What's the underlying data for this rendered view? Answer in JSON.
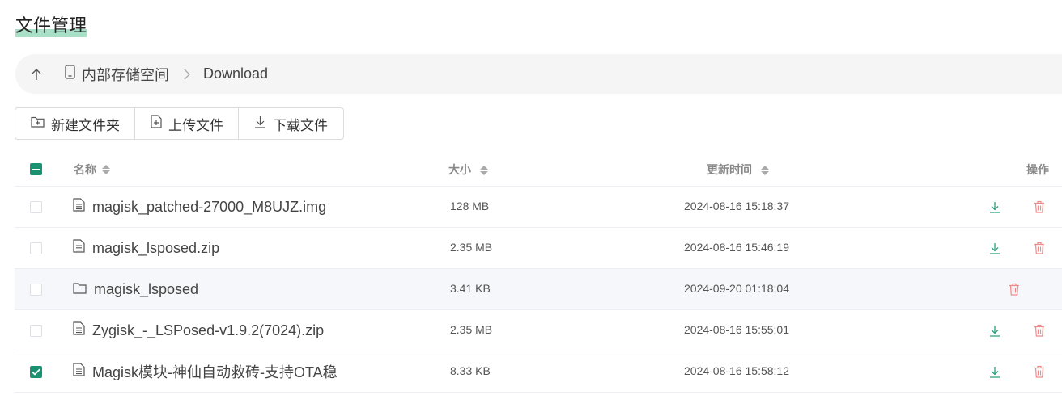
{
  "page": {
    "title": "文件管理"
  },
  "path": {
    "up_icon": "arrow-up-icon",
    "device_icon": "phone-icon",
    "device": "内部存储空间",
    "current": "Download"
  },
  "toolbar": {
    "new_folder": "新建文件夹",
    "upload": "上传文件",
    "download": "下载文件"
  },
  "table": {
    "headers": {
      "name": "名称",
      "size": "大小",
      "time": "更新时间",
      "ops": "操作"
    },
    "rows": [
      {
        "name": "magisk_patched-27000_M8UJZ.img",
        "size": "128 MB",
        "time": "2024-08-16 15:18:37",
        "type": "file",
        "checked": false
      },
      {
        "name": "magisk_lsposed.zip",
        "size": "2.35 MB",
        "time": "2024-08-16 15:46:19",
        "type": "file",
        "checked": false
      },
      {
        "name": "magisk_lsposed",
        "size": "3.41 KB",
        "time": "2024-09-20 01:18:04",
        "type": "folder",
        "checked": false
      },
      {
        "name": "Zygisk_-_LSPosed-v1.9.2(7024).zip",
        "size": "2.35 MB",
        "time": "2024-08-16 15:55:01",
        "type": "file",
        "checked": false
      },
      {
        "name": "Magisk模块-神仙自动救砖-支持OTA稳",
        "size": "8.33 KB",
        "time": "2024-08-16 15:58:12",
        "type": "file",
        "checked": true
      }
    ]
  },
  "colors": {
    "accent": "#1a9171",
    "download": "#2aa07f",
    "delete": "#f08a8a",
    "title_highlight": "#a8dfc7"
  }
}
